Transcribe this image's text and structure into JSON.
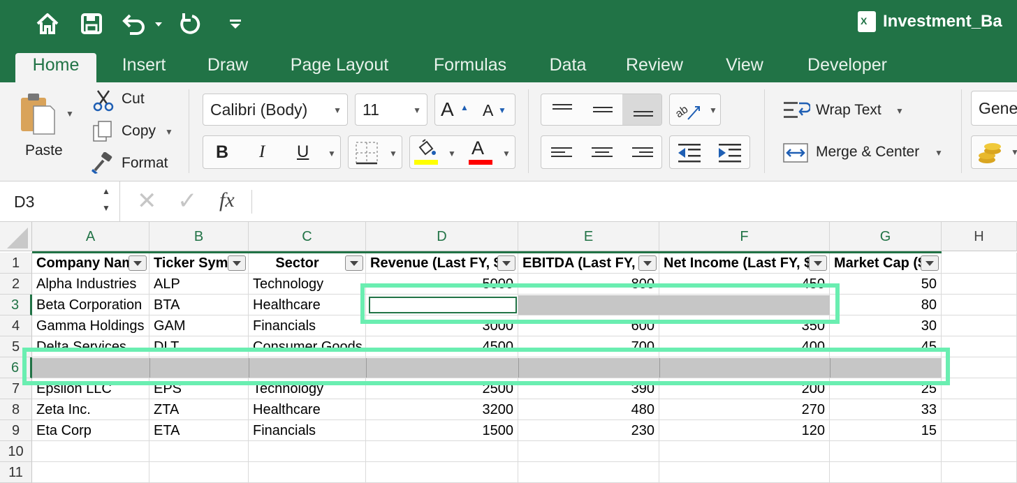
{
  "app": {
    "title": "Investment_Ba"
  },
  "tabs": [
    "Home",
    "Insert",
    "Draw",
    "Page Layout",
    "Formulas",
    "Data",
    "Review",
    "View",
    "Developer"
  ],
  "clipboard": {
    "paste": "Paste",
    "cut": "Cut",
    "copy": "Copy",
    "format": "Format"
  },
  "font": {
    "name": "Calibri (Body)",
    "size": "11",
    "grow": "A",
    "shrink": "A",
    "bold": "B",
    "italic": "I",
    "underline": "U",
    "color_letter": "A",
    "fill_color": "#ffff00",
    "font_color": "#ff0000"
  },
  "alignment": {
    "wrap_text": "Wrap Text",
    "merge_center": "Merge & Center"
  },
  "number": {
    "format": "Gene"
  },
  "formula_bar": {
    "name_box": "D3",
    "fx": "fx",
    "content": ""
  },
  "columns": [
    "A",
    "B",
    "C",
    "D",
    "E",
    "F",
    "G",
    "H"
  ],
  "rows": [
    "1",
    "2",
    "3",
    "4",
    "5",
    "6",
    "7",
    "8",
    "9",
    "10",
    "11"
  ],
  "headers": [
    "Company Nam",
    "Ticker Symb",
    "Sector",
    "Revenue (Last FY, $I",
    "EBITDA (Last FY, $I",
    "Net Income (Last FY, $I",
    "Market Cap ($"
  ],
  "data_rows": [
    [
      "Alpha Industries",
      "ALP",
      "Technology",
      "5000",
      "800",
      "450",
      "50"
    ],
    [
      "Beta Corporation",
      "BTA",
      "Healthcare",
      "",
      "",
      "",
      "80"
    ],
    [
      "Gamma Holdings",
      "GAM",
      "Financials",
      "3000",
      "600",
      "350",
      "30"
    ],
    [
      "Delta Services",
      "DLT",
      "Consumer Goods",
      "4500",
      "700",
      "400",
      "45"
    ],
    [
      "",
      "",
      "",
      "",
      "",
      "",
      ""
    ],
    [
      "Epsilon LLC",
      "EPS",
      "Technology",
      "2500",
      "390",
      "200",
      "25"
    ],
    [
      "Zeta Inc.",
      "ZTA",
      "Healthcare",
      "3200",
      "480",
      "270",
      "33"
    ],
    [
      "Eta Corp",
      "ETA",
      "Financials",
      "1500",
      "230",
      "120",
      "15"
    ],
    [
      "",
      "",
      "",
      "",
      "",
      "",
      ""
    ],
    [
      "",
      "",
      "",
      "",
      "",
      "",
      ""
    ]
  ],
  "colors": {
    "brand": "#217346",
    "highlight": "#6aeeb1",
    "masked": "#c6c6c6"
  }
}
